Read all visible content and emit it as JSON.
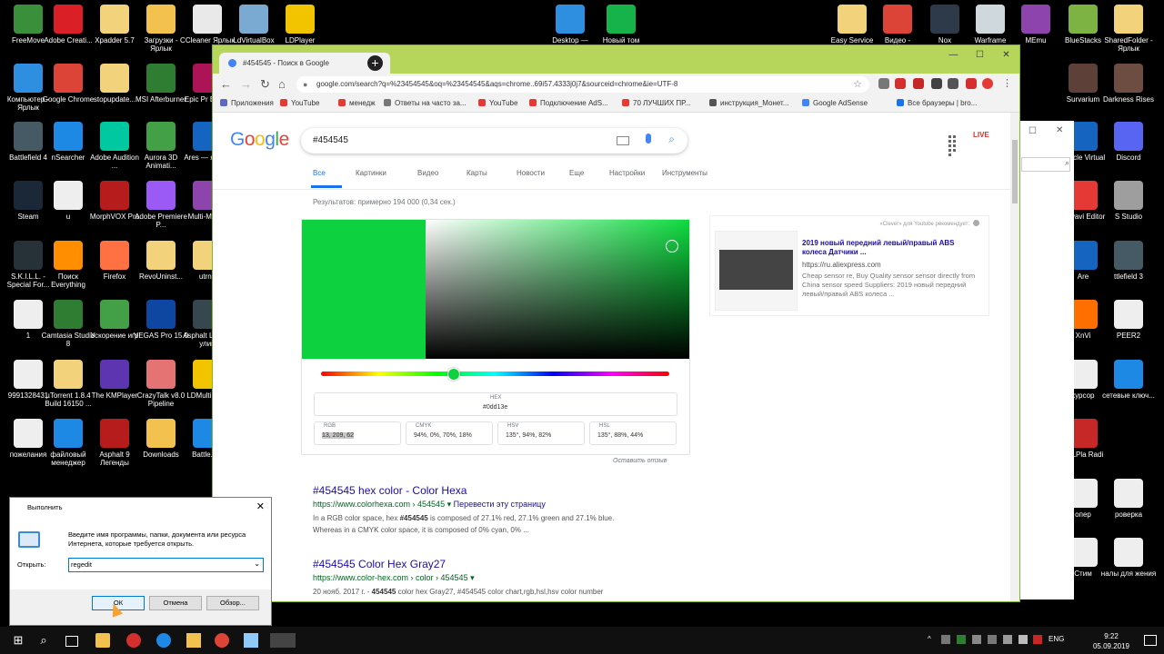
{
  "desktop_icons": [
    {
      "label": "FreeMove",
      "color": "#3a8f3a"
    },
    {
      "label": "Adobe Creati...",
      "color": "#da1f26"
    },
    {
      "label": "Xpadder 5.7",
      "color": "#f2d27a"
    },
    {
      "label": "Загрузки - Ярлык",
      "color": "#f2c14e"
    },
    {
      "label": "CCleaner Ярлык",
      "color": "#e9e9e9"
    },
    {
      "label": "LdVirtualBox",
      "color": "#7aa9d1"
    },
    {
      "label": "LDPlayer",
      "color": "#f2c400"
    },
    {
      "label": "Desktop —",
      "color": "#2e8fe0"
    },
    {
      "label": "Новый том",
      "color": "#16b34a"
    },
    {
      "label": "Easy Service",
      "color": "#f2d27a"
    },
    {
      "label": "Видео -",
      "color": "#db4437"
    },
    {
      "label": "Nox",
      "color": "#2e3a4a"
    },
    {
      "label": "Warframe",
      "color": "#cfd8dc"
    },
    {
      "label": "MEmu",
      "color": "#8e44ad"
    },
    {
      "label": "BlueStacks",
      "color": "#7cb342"
    },
    {
      "label": "SharedFolder - Ярлык",
      "color": "#f2d27a"
    },
    {
      "label": "Компьютер - Ярлык",
      "color": "#2e8fe0"
    },
    {
      "label": "Google Chrome",
      "color": "#db4437"
    },
    {
      "label": "stopupdate...",
      "color": "#f2d27a"
    },
    {
      "label": "MSI Afterburner",
      "color": "#2e7d32"
    },
    {
      "label": "Epic Pr Brows",
      "color": "#ad1457"
    },
    {
      "label": "Survarium",
      "color": "#5d4037"
    },
    {
      "label": "Darkness Rises",
      "color": "#6d4c41"
    },
    {
      "label": "Battlefield 4",
      "color": "#455a64"
    },
    {
      "label": "nSearcher",
      "color": "#1e88e5"
    },
    {
      "label": "Adobe Audition ...",
      "color": "#00c8a0"
    },
    {
      "label": "Aurora 3D Animati...",
      "color": "#43a047"
    },
    {
      "label": "Ares — ярлык",
      "color": "#1565c0"
    },
    {
      "label": "Oracle Virtual",
      "color": "#1565c0"
    },
    {
      "label": "Discord",
      "color": "#5865f2"
    },
    {
      "label": "Steam",
      "color": "#1b2838"
    },
    {
      "label": "u",
      "color": "#eeeeee"
    },
    {
      "label": "MorphVOX Pro",
      "color": "#b71c1c"
    },
    {
      "label": "Adobe Premiere P...",
      "color": "#9b59f5"
    },
    {
      "label": "Multi-MEmu",
      "color": "#8e44ad"
    },
    {
      "label": "Movavi Editor",
      "color": "#e53935"
    },
    {
      "label": "S Studio",
      "color": "#9e9e9e"
    },
    {
      "label": "S.K.I.L.L. - Special For...",
      "color": "#263238"
    },
    {
      "label": "Поиск Everything",
      "color": "#ff8f00"
    },
    {
      "label": "Firefox",
      "color": "#ff7043"
    },
    {
      "label": "RevoUninst...",
      "color": "#f2d27a"
    },
    {
      "label": "utrnp",
      "color": "#f2d27a"
    },
    {
      "label": "Are",
      "color": "#1565c0"
    },
    {
      "label": "ttlefield 3",
      "color": "#455a64"
    },
    {
      "label": "1",
      "color": "#eeeeee"
    },
    {
      "label": "Camtasia Studio 8",
      "color": "#2e7d32"
    },
    {
      "label": "Ускорение игр",
      "color": "#43a047"
    },
    {
      "label": "VEGAS Pro 15.0",
      "color": "#0d47a1"
    },
    {
      "label": "Asphalt Штурм улиц",
      "color": "#37474f"
    },
    {
      "label": "XnVi",
      "color": "#ff6f00"
    },
    {
      "label": "PEER2",
      "color": "#eeeeee"
    },
    {
      "label": "9991328431",
      "color": "#eeeeee"
    },
    {
      "label": "µTorrent 1.8.4 Build 16150 ...",
      "color": "#f2d27a"
    },
    {
      "label": "The KMPlayer",
      "color": "#5e35b1"
    },
    {
      "label": "CrazyTalk v8.0 Pipeline",
      "color": "#e57373"
    },
    {
      "label": "LDMultiPla...",
      "color": "#f2c400"
    },
    {
      "label": "курсор",
      "color": "#eeeeee"
    },
    {
      "label": "сетевые ключ...",
      "color": "#1e88e5"
    },
    {
      "label": "пожелания",
      "color": "#eeeeee"
    },
    {
      "label": "файловый менеджер",
      "color": "#1e88e5"
    },
    {
      "label": "Asphalt 9 Легенды",
      "color": "#b71c1c"
    },
    {
      "label": "Downloads",
      "color": "#f2c14e"
    },
    {
      "label": "Battle.net",
      "color": "#1e88e5"
    },
    {
      "label": "ALLPla Radi",
      "color": "#c62828"
    },
    {
      "label": "опер",
      "color": "#eeeeee"
    },
    {
      "label": "роверка",
      "color": "#eeeeee"
    },
    {
      "label": "Стим",
      "color": "#eeeeee"
    },
    {
      "label": "налы для жения",
      "color": "#eeeeee"
    },
    {
      "label": "Корзина",
      "color": "#90caf9"
    }
  ],
  "browser": {
    "tab_title": "#454545 - Поиск в Google",
    "tab_close": "×",
    "new_tab": "+",
    "win_min": "—",
    "win_max": "☐",
    "win_close": "✕",
    "nav_back": "←",
    "nav_forward": "→",
    "nav_reload": "↻",
    "nav_home": "⌂",
    "url": "google.com/search?q=%23454545&oq=%23454545&aqs=chrome..69i57.4333j0j7&sourceid=chrome&ie=UTF-8",
    "bookmarks": [
      "Приложения",
      "YouTube",
      "менедж",
      "Ответы на часто за...",
      "YouTube",
      "Подключение AdS...",
      "70 ЛУЧШИХ ПР...",
      "инструкция_Монет...",
      "Google AdSense",
      "Все браузеры | bro..."
    ],
    "menu": "⋮"
  },
  "google": {
    "logo": [
      {
        "ch": "G",
        "color": "#4285f4"
      },
      {
        "ch": "o",
        "color": "#ea4335"
      },
      {
        "ch": "o",
        "color": "#fbbc05"
      },
      {
        "ch": "g",
        "color": "#4285f4"
      },
      {
        "ch": "l",
        "color": "#34a853"
      },
      {
        "ch": "e",
        "color": "#ea4335"
      }
    ],
    "query": "#454545",
    "search_icon": "⌕",
    "avatar_text": "LIVE",
    "tabs": [
      "Все",
      "Картинки",
      "Видео",
      "Карты",
      "Новости",
      "Еще",
      "Настройки",
      "Инструменты"
    ],
    "stats": "Результатов: примерно 194 000 (0,34 сек.)",
    "picker": {
      "color": "#0dd13e",
      "hex_label": "HEX",
      "hex_value": "#0dd13e",
      "rgb_label": "RGB",
      "rgb_value": "13, 209, 62",
      "cmyk_label": "CMYK",
      "cmyk_value": "94%, 0%, 70%, 18%",
      "hsv_label": "HSV",
      "hsv_value": "135°, 94%, 82%",
      "hsl_label": "HSL",
      "hsl_value": "135°, 88%, 44%",
      "feedback": "Оставить отзыв"
    },
    "ad": {
      "recommend": "«Clever» для Youtube рекомендует:",
      "title": "2019 новый передний левый/правый ABS колеса Датчики ...",
      "url": "https://ru.aliexpress.com",
      "desc": "Cheap sensor re, Buy Quality sensor sensor directly from China sensor speed Suppliers: 2019 новый передний левый/правый ABS колеса ..."
    },
    "results": [
      {
        "title": "#454545 hex color - Color Hexa",
        "url": "https://www.colorhexa.com › 454545",
        "translate": "Перевести эту страницу",
        "snippet1_pre": "In a RGB color space, hex ",
        "snippet1_bold": "#454545",
        "snippet1_post": " is composed of 27.1% red, 27.1% green and 27.1% blue.",
        "snippet2": "Whereas in a CMYK color space, it is composed of 0% cyan, 0% ..."
      },
      {
        "title": "#454545 Color Hex Gray27",
        "url": "https://www.color-hex.com › color › 454545",
        "snippet1_pre": "20 нояб. 2017 г. - ",
        "snippet1_bold": "454545",
        "snippet1_post": " color hex Gray27, #454545 color chart,rgb,hsl,hsv color number"
      }
    ]
  },
  "run_dialog": {
    "title": "Выполнить",
    "close": "✕",
    "description": "Введите имя программы, папки, документа или ресурса Интернета, которые требуется открыть.",
    "open_label": "Открыть:",
    "input_value": "regedit",
    "dropdown": "⌄",
    "ok": "ОК",
    "cancel": "Отмена",
    "browse": "Обзор..."
  },
  "taskbar": {
    "start": "⊞",
    "search": "⌕",
    "tray_up": "^",
    "lang": "ENG",
    "time": "9:22",
    "date": "05.09.2019"
  }
}
